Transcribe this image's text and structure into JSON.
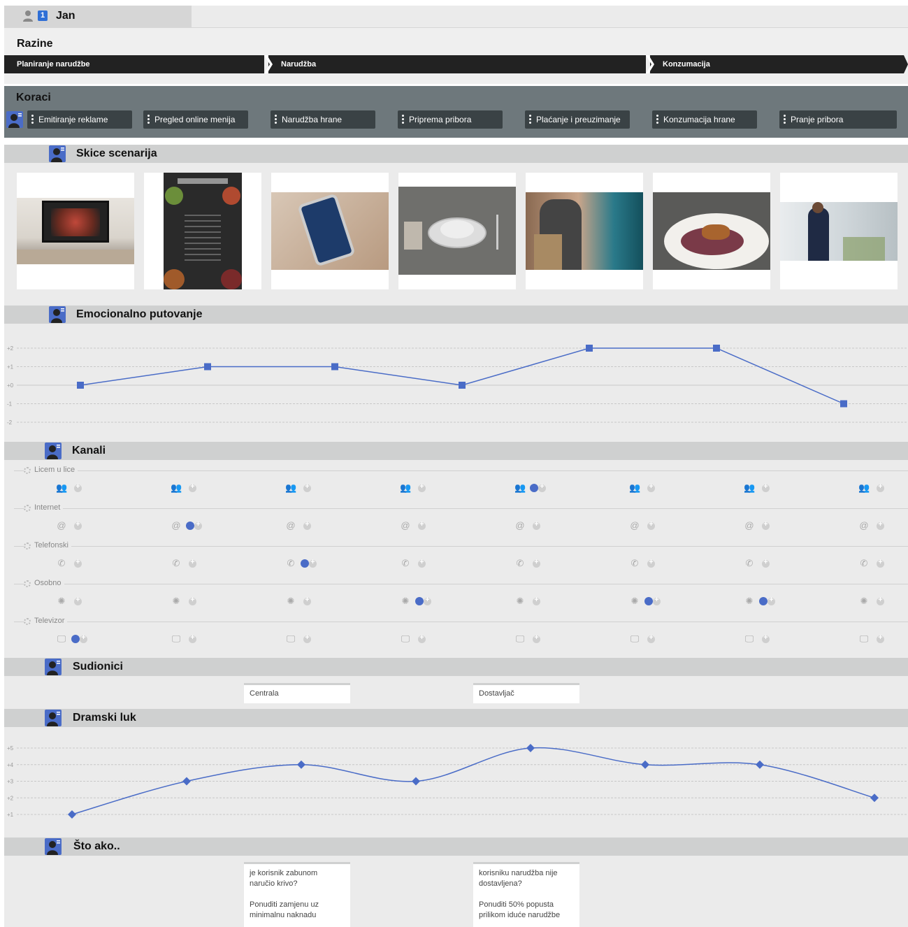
{
  "user": {
    "name": "Jan",
    "badge": "1"
  },
  "levels": {
    "title": "Razine",
    "items": [
      {
        "label": "Planiranje narudžbe"
      },
      {
        "label": "Narudžba"
      },
      {
        "label": "Konzumacija"
      }
    ]
  },
  "steps": {
    "title": "Koraci",
    "items": [
      {
        "label": "Emitiranje reklame"
      },
      {
        "label": "Pregled online menija"
      },
      {
        "label": "Narudžba hrane"
      },
      {
        "label": "Priprema pribora"
      },
      {
        "label": "Plaćanje i preuzimanje"
      },
      {
        "label": "Konzumacija hrane"
      },
      {
        "label": "Pranje pribora"
      }
    ]
  },
  "sections": {
    "sketches": "Skice scenarija",
    "emotional": "Emocionalno putovanje",
    "channels": "Kanali",
    "participants": "Sudionici",
    "drama": "Dramski luk",
    "whatif": "Što ako.."
  },
  "sketches": [
    {
      "icon": "tv-advert-photo-icon"
    },
    {
      "icon": "menu-board-photo-icon"
    },
    {
      "icon": "phone-dialing-photo-icon"
    },
    {
      "icon": "table-setting-photo-icon"
    },
    {
      "icon": "delivery-payment-photo-icon"
    },
    {
      "icon": "eating-meal-photo-icon"
    },
    {
      "icon": "washing-dishes-photo-icon"
    }
  ],
  "chart_data": [
    {
      "type": "line",
      "ylim": [
        -2,
        2
      ],
      "yticks": [
        "+2",
        "+1",
        "+0",
        "-1",
        "-2"
      ],
      "x": [
        1,
        2,
        3,
        4,
        5,
        6,
        7
      ],
      "series": [
        {
          "values": [
            0,
            1,
            1,
            0,
            2,
            2,
            -1
          ]
        }
      ],
      "color": "#4a6cc7"
    },
    {
      "type": "line",
      "ylim": [
        1,
        5
      ],
      "yticks": [
        "+5",
        "+4",
        "+3",
        "+2",
        "+1"
      ],
      "x": [
        1,
        2,
        3,
        4,
        5,
        6,
        7,
        8
      ],
      "series": [
        {
          "values": [
            1,
            3,
            4,
            3,
            5,
            4,
            4,
            2
          ]
        }
      ],
      "color": "#4a6cc7"
    }
  ],
  "channels": {
    "rows": [
      {
        "label": "Licem u lice",
        "icon": "people-icon",
        "glyph": "👥",
        "selected": [
          4
        ]
      },
      {
        "label": "Internet",
        "icon": "at-sign-icon",
        "glyph": "@",
        "selected": [
          1
        ]
      },
      {
        "label": "Telefonski",
        "icon": "phone-icon",
        "glyph": "✆",
        "selected": [
          2
        ]
      },
      {
        "label": "Osobno",
        "icon": "person-spark-icon",
        "glyph": "✺",
        "selected": [
          3,
          5,
          6
        ]
      },
      {
        "label": "Televizor",
        "icon": "monitor-icon",
        "glyph": "🖵",
        "selected": [
          0
        ]
      }
    ]
  },
  "participants": [
    {
      "label": "Centrala"
    },
    {
      "label": "Dostavljač"
    }
  ],
  "whatif": [
    {
      "question": "je korisnik zabunom naručio krivo?",
      "answer": "Ponuditi zamjenu uz minimalnu naknadu"
    },
    {
      "question": "korisniku narudžba nije dostavljena?",
      "answer": "Ponuditi 50% popusta prilikom iduće narudžbe"
    }
  ],
  "colors": {
    "accent": "#4a6cc7",
    "steps_bg": "#6e787c",
    "level_bg": "#222222"
  }
}
